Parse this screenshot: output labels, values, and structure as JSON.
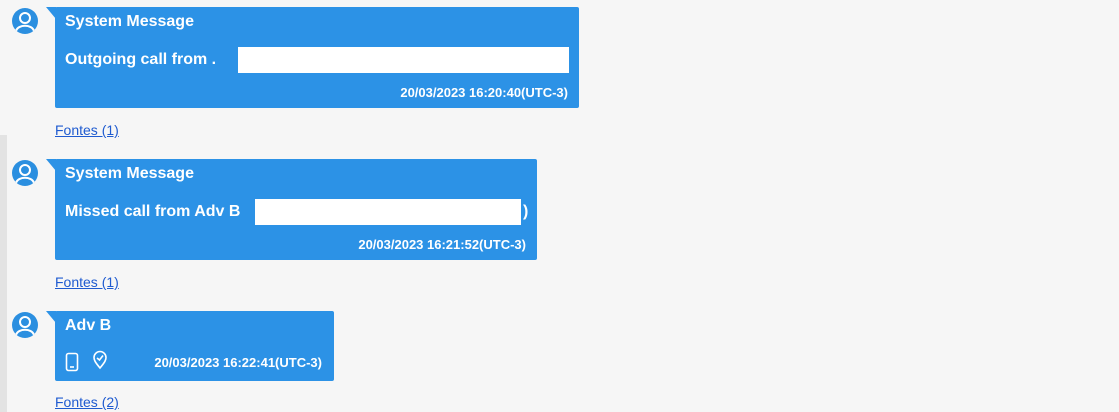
{
  "messages": [
    {
      "sender": "System Message",
      "body": "Outgoing call from .",
      "body_suffix": "",
      "timestamp": "20/03/2023 16:20:40(UTC-3)",
      "sources": "Fontes (1)"
    },
    {
      "sender": "System Message",
      "body": "Missed call from Adv B",
      "body_suffix": ")",
      "timestamp": "20/03/2023 16:21:52(UTC-3)",
      "sources": "Fontes (1)"
    },
    {
      "sender": "Adv B",
      "body": "",
      "body_suffix": "",
      "timestamp": "20/03/2023 16:22:41(UTC-3)",
      "sources": "Fontes (2)",
      "icons": [
        "phone-device-icon",
        "location-pin-icon"
      ]
    }
  ],
  "colors": {
    "bubble": "#2c92e6",
    "avatar": "#2b8fe0",
    "link": "#1f5bd0",
    "background": "#f6f6f6"
  }
}
